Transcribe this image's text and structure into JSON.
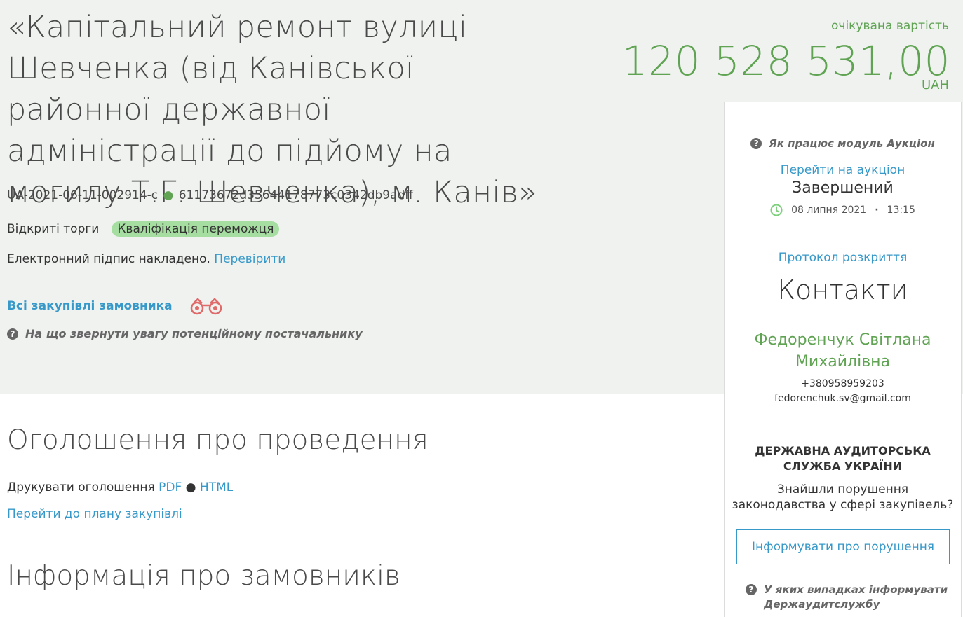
{
  "tender": {
    "title": "«Капітальний ремонт вулиці Шевченка (від Канівської районної державної адміністрації до підйому на могилу Т.Г. Шевченка), м. Канів»",
    "id": "UA-2021-06-11-002914-c",
    "hash": "61173672d35644178773c0342db9adff",
    "procedure": "Відкриті торги",
    "status": "Кваліфікація переможця",
    "signature_text": "Електронний підпис накладено.",
    "signature_check": "Перевірити",
    "all_purchases": "Всі закупівлі замовника",
    "attention": "На що звернути увагу потенційному постачальнику"
  },
  "price": {
    "label": "очікувана вартість",
    "amount": "120 528 531,00",
    "currency": "UAH"
  },
  "auction": {
    "help": "Як працює модуль Аукціон",
    "link": "Перейти на аукціон",
    "status": "Завершений",
    "date": "08 липня 2021",
    "time": "13:15",
    "protocol": "Протокол розкриття"
  },
  "contacts": {
    "title": "Контакти",
    "name": "Федоренчук Світлана Михайлівна",
    "phone": "+380958959203",
    "email": "fedorenchuk.sv@gmail.com"
  },
  "audit": {
    "title": "ДЕРЖАВНА АУДИТОРСЬКА СЛУЖБА УКРАЇНИ",
    "question": "Знайшли порушення законодавства у сфері закупівель?",
    "button": "Інформувати про порушення",
    "help": "У яких випадках інформувати Держаудитслужбу"
  },
  "announcement": {
    "title": "Оголошення про проведення",
    "print_label": "Друкувати оголошення",
    "pdf": "PDF",
    "html": "HTML",
    "plan_link": "Перейти до плану закупівлі"
  },
  "customers": {
    "title": "Інформація про замовників"
  },
  "colors": {
    "accent_green": "#5fa353",
    "link_blue": "#3799c9",
    "badge_green": "#a6dda1",
    "header_bg": "#eff2ef",
    "binoculars": "#e06a6a"
  },
  "icons": {
    "binoculars": "binoculars-icon",
    "question": "question-circle-icon",
    "clock": "clock-icon"
  }
}
